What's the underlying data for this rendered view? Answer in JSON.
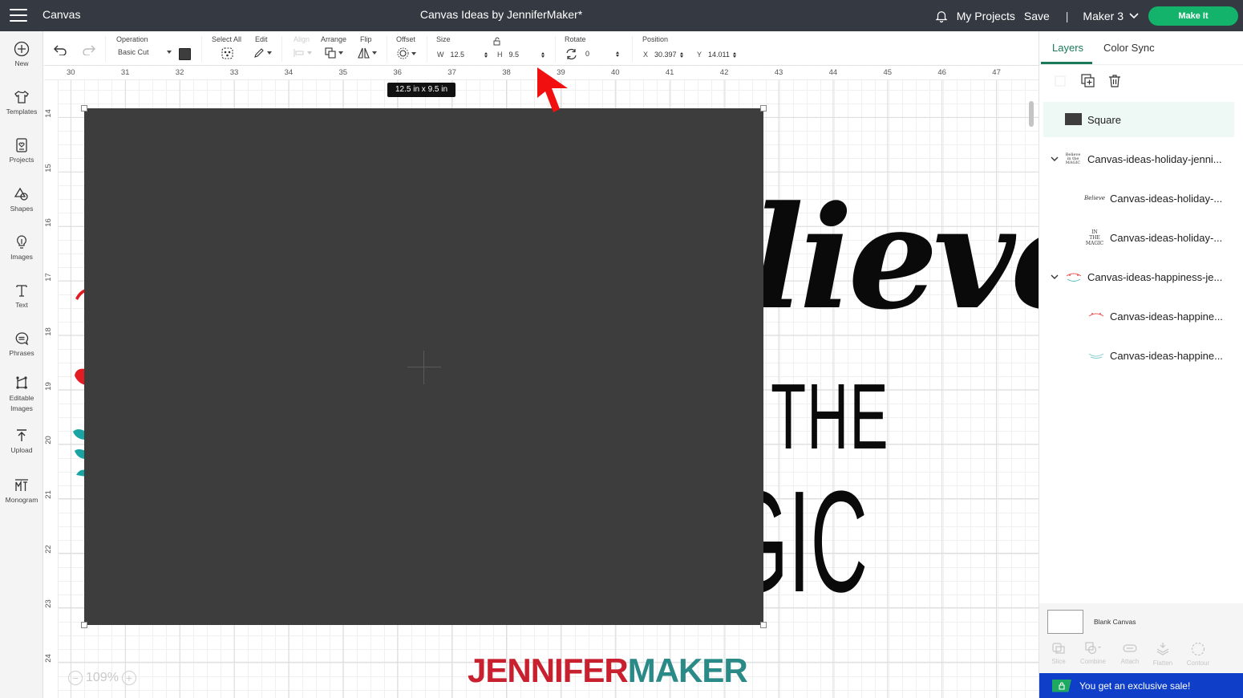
{
  "topbar": {
    "menu_icon": "hamburger-icon",
    "app_title": "Canvas",
    "project_title": "Canvas Ideas by JenniferMaker*",
    "notifications_icon": "bell-icon",
    "my_projects": "My Projects",
    "save": "Save",
    "separator": "|",
    "machine": "Maker 3",
    "make_it": "Make It",
    "colors": {
      "bar": "#353a42",
      "make_it": "#13b36b"
    }
  },
  "toolbar": {
    "undo_icon": "undo-icon",
    "redo_icon": "redo-icon",
    "operation": {
      "label": "Operation",
      "value": "Basic Cut",
      "color": "#3d3d3d"
    },
    "select_all": "Select All",
    "edit": "Edit",
    "align": "Align",
    "arrange": "Arrange",
    "flip": "Flip",
    "offset": "Offset",
    "size": {
      "label": "Size",
      "w_label": "W",
      "w_value": "12.5",
      "h_label": "H",
      "h_value": "9.5",
      "lock_icon": "unlock-icon"
    },
    "rotate": {
      "label": "Rotate",
      "value": "0"
    },
    "position": {
      "label": "Position",
      "x_label": "X",
      "x_value": "30.397",
      "y_label": "Y",
      "y_value": "14.011"
    }
  },
  "sidebar": {
    "items": [
      {
        "label": "New",
        "icon": "plus-circle-icon"
      },
      {
        "label": "Templates",
        "icon": "shirt-icon"
      },
      {
        "label": "Projects",
        "icon": "projects-icon"
      },
      {
        "label": "Shapes",
        "icon": "shapes-icon"
      },
      {
        "label": "Images",
        "icon": "lightbulb-icon"
      },
      {
        "label": "Text",
        "icon": "text-icon"
      },
      {
        "label": "Phrases",
        "icon": "speech-bubble-icon"
      },
      {
        "label": "Editable Images",
        "icon": "editable-images-icon"
      },
      {
        "label": "Upload",
        "icon": "upload-icon"
      },
      {
        "label": "Monogram",
        "icon": "monogram-icon"
      }
    ]
  },
  "canvas": {
    "ruler_top": [
      "30",
      "31",
      "32",
      "33",
      "34",
      "35",
      "36",
      "37",
      "38",
      "39",
      "40",
      "41",
      "42",
      "43",
      "44",
      "45",
      "46",
      "47"
    ],
    "ruler_left": [
      "14",
      "15",
      "16",
      "17",
      "18",
      "19",
      "20",
      "21",
      "22",
      "23",
      "24"
    ],
    "size_tooltip": "12.5  in x 9.5  in",
    "design_text": {
      "line1": "elieve",
      "line2": "N THE",
      "line3": "AGIC"
    },
    "zoom": {
      "value": "109%",
      "minus": "−",
      "plus": "+"
    },
    "watermark": {
      "part1": "JENNIFER",
      "part2": "MAKER",
      "color1": "#c8202f",
      "color2": "#2a8a87"
    },
    "shape_color": "#3d3d3d"
  },
  "layers_panel": {
    "tabs": [
      {
        "label": "Layers",
        "active": true
      },
      {
        "label": "Color Sync",
        "active": false
      }
    ],
    "tools": [
      "group-icon",
      "duplicate-icon",
      "delete-icon"
    ],
    "layers": [
      {
        "name": "Square",
        "level": 0,
        "expandable": false,
        "selected": true
      },
      {
        "name": "Canvas-ideas-holiday-jenni...",
        "level": 0,
        "expandable": true,
        "selected": false
      },
      {
        "name": "Canvas-ideas-holiday-...",
        "level": 1,
        "expandable": false,
        "selected": false
      },
      {
        "name": "Canvas-ideas-holiday-...",
        "level": 1,
        "expandable": false,
        "selected": false
      },
      {
        "name": "Canvas-ideas-happiness-je...",
        "level": 0,
        "expandable": true,
        "selected": false
      },
      {
        "name": "Canvas-ideas-happine...",
        "level": 1,
        "expandable": false,
        "selected": false
      },
      {
        "name": "Canvas-ideas-happine...",
        "level": 1,
        "expandable": false,
        "selected": false
      }
    ],
    "blank_canvas": "Blank Canvas",
    "bottom_tools": [
      "Slice",
      "Combine",
      "Attach",
      "Flatten",
      "Contour"
    ],
    "sale_banner": "You get an exclusive sale!"
  }
}
